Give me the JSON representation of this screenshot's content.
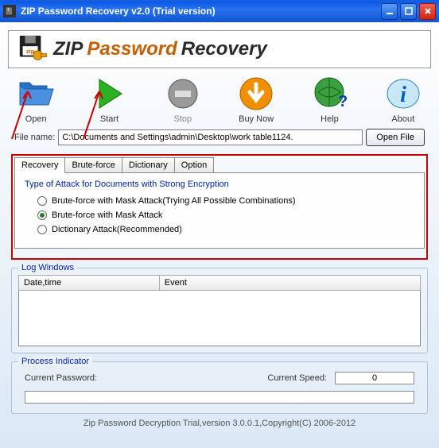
{
  "titlebar": {
    "title": "ZIP Password Recovery v2.0 (Trial version)"
  },
  "banner": {
    "zip": "ZIP",
    "password": "Password",
    "recovery": "Recovery"
  },
  "toolbar": {
    "open": "Open",
    "start": "Start",
    "stop": "Stop",
    "buy": "Buy Now",
    "help": "Help",
    "about": "About"
  },
  "file": {
    "label": "File name:",
    "value": "C:\\Documents and Settings\\admin\\Desktop\\work table1124.",
    "open_btn": "Open File"
  },
  "tabs": {
    "recovery": "Recovery",
    "brute": "Brute-force",
    "dictionary": "Dictionary",
    "option": "Option"
  },
  "attack": {
    "title": "Type of Attack for Documents with Strong Encryption",
    "opt1": "Brute-force with Mask Attack(Trying All Possible Combinations)",
    "opt2": "Brute-force with Mask Attack",
    "opt3": "Dictionary Attack(Recommended)"
  },
  "log": {
    "legend": "Log Windows",
    "col1": "Date,time",
    "col2": "Event"
  },
  "process": {
    "legend": "Process Indicator",
    "password": "Current Password:",
    "speed": "Current Speed:",
    "speed_value": "0"
  },
  "statusbar": "Zip Password Decryption Trial,version 3.0.0.1,Copyright(C) 2006-2012"
}
